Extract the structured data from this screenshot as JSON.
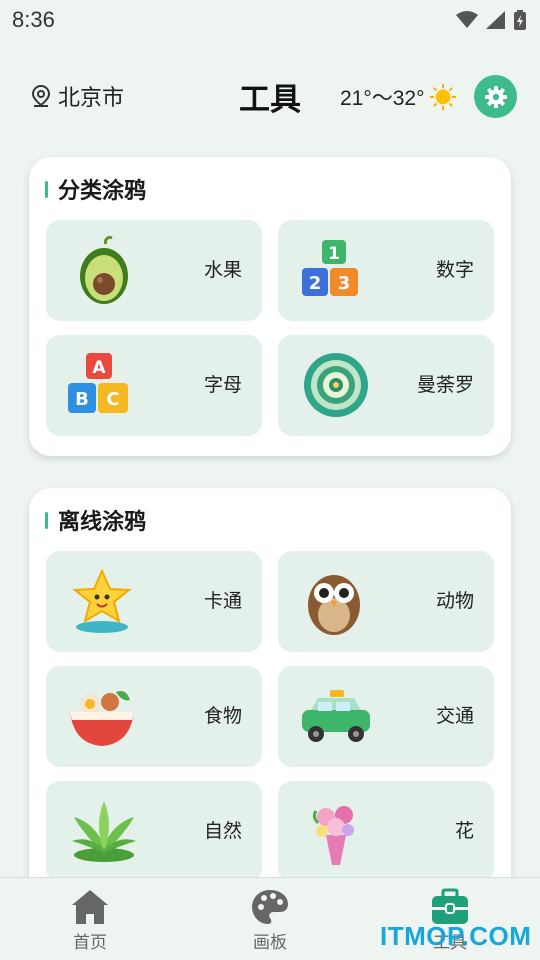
{
  "status_bar": {
    "time": "8:36",
    "icons": [
      "wifi-icon",
      "signal-icon",
      "battery-icon"
    ]
  },
  "header": {
    "location": "北京市",
    "title": "工具",
    "weather": "21°～32°",
    "weather_icon": "sun-icon",
    "settings_icon": "gear-icon"
  },
  "colors": {
    "accent": "#3dbb8a",
    "tile_bg": "#e3f1ea",
    "page_bg": "#eef5f1",
    "active_nav": "#1fa07a"
  },
  "sections": [
    {
      "title": "分类涂鸦",
      "items": [
        {
          "label": "水果",
          "icon": "avocado-icon"
        },
        {
          "label": "数字",
          "icon": "number-blocks-icon"
        },
        {
          "label": "字母",
          "icon": "letter-blocks-icon"
        },
        {
          "label": "曼荼罗",
          "icon": "mandala-icon"
        }
      ]
    },
    {
      "title": "离线涂鸦",
      "items": [
        {
          "label": "卡通",
          "icon": "star-cartoon-icon"
        },
        {
          "label": "动物",
          "icon": "owl-icon"
        },
        {
          "label": "食物",
          "icon": "food-bowl-icon"
        },
        {
          "label": "交通",
          "icon": "taxi-icon"
        },
        {
          "label": "自然",
          "icon": "plant-icon"
        },
        {
          "label": "花",
          "icon": "flower-bouquet-icon"
        }
      ]
    }
  ],
  "bottom_nav": [
    {
      "label": "首页",
      "icon": "home-icon",
      "active": false
    },
    {
      "label": "画板",
      "icon": "palette-icon",
      "active": false
    },
    {
      "label": "工具",
      "icon": "toolbox-icon",
      "active": true
    }
  ],
  "watermark": "ITMOP.COM"
}
